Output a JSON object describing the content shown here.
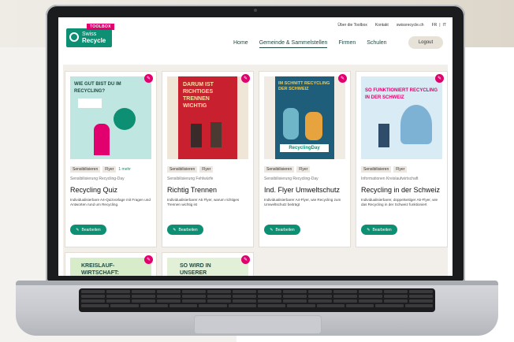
{
  "brand": {
    "tag": "TOOLBOX",
    "line1": "Swiss",
    "line2": "Recycle",
    "color": "#0d8f74",
    "accent": "#e2006e"
  },
  "utility": {
    "about": "Über die Toolbox",
    "contact": "Kontakt",
    "site": "swissrecycle.ch",
    "lang_fr": "FR",
    "lang_sep": "|",
    "lang_it": "IT"
  },
  "nav": {
    "home": "Home",
    "gemeinde": "Gemeinde & Sammelstellen",
    "firmen": "Firmen",
    "schulen": "Schulen",
    "logout": "Logout"
  },
  "cards": [
    {
      "poster": "WIE GUT BIST DU IM RECYCLING?",
      "tags": [
        "Sensibilisieren",
        "Flyer"
      ],
      "more": "1 mehr",
      "meta": "Sensibilisierung  Recycling-Day",
      "title": "Recycling Quiz",
      "desc": "Individualisierbare A4-Quizvorlage mit Fragen und Antworten rund um Recycling.",
      "button": "Bearbeiten"
    },
    {
      "poster": "DARUM IST RICHTIGES TRENNEN WICHTIG",
      "tags": [
        "Sensibilisieren",
        "Flyer"
      ],
      "more": "",
      "meta": "Sensibilisierung  Fehlwürfe",
      "title": "Richtig Trennen",
      "desc": "Individualisierbarer A5 Flyer, warum richtiges Trennen wichtig ist",
      "button": "Bearbeiten"
    },
    {
      "poster": "IM SCHNITT RECYCLING DER SCHWEIZ",
      "poster_badge": "RecyclingDay",
      "tags": [
        "Sensibilisieren",
        "Flyer"
      ],
      "more": "",
      "meta": "Sensibilisierung  Recycling-Day",
      "title": "Ind. Flyer Umweltschutz",
      "desc": "Individualisierbarer A4-Flyer, wie Recycling zum Umweltschutz beiträgt",
      "button": "Bearbeiten"
    },
    {
      "poster": "SO FUNKTIONIERT RECYCLING IN DER SCHWEIZ",
      "tags": [
        "Sensibilisieren",
        "Flyer"
      ],
      "more": "",
      "meta": "Informationen  Kreislaufwirtschaft",
      "title": "Recycling in der Schweiz",
      "desc": "Individualisierbarer, doppelseitiger A5-Flyer, wie das Recycling in der Schweiz funktioniert",
      "button": "Bearbeiten"
    }
  ],
  "bottom_cards": [
    {
      "poster": "KREISLAUF-WIRTSCHAFT:"
    },
    {
      "poster": "SO WIRD IN UNSERER"
    }
  ]
}
